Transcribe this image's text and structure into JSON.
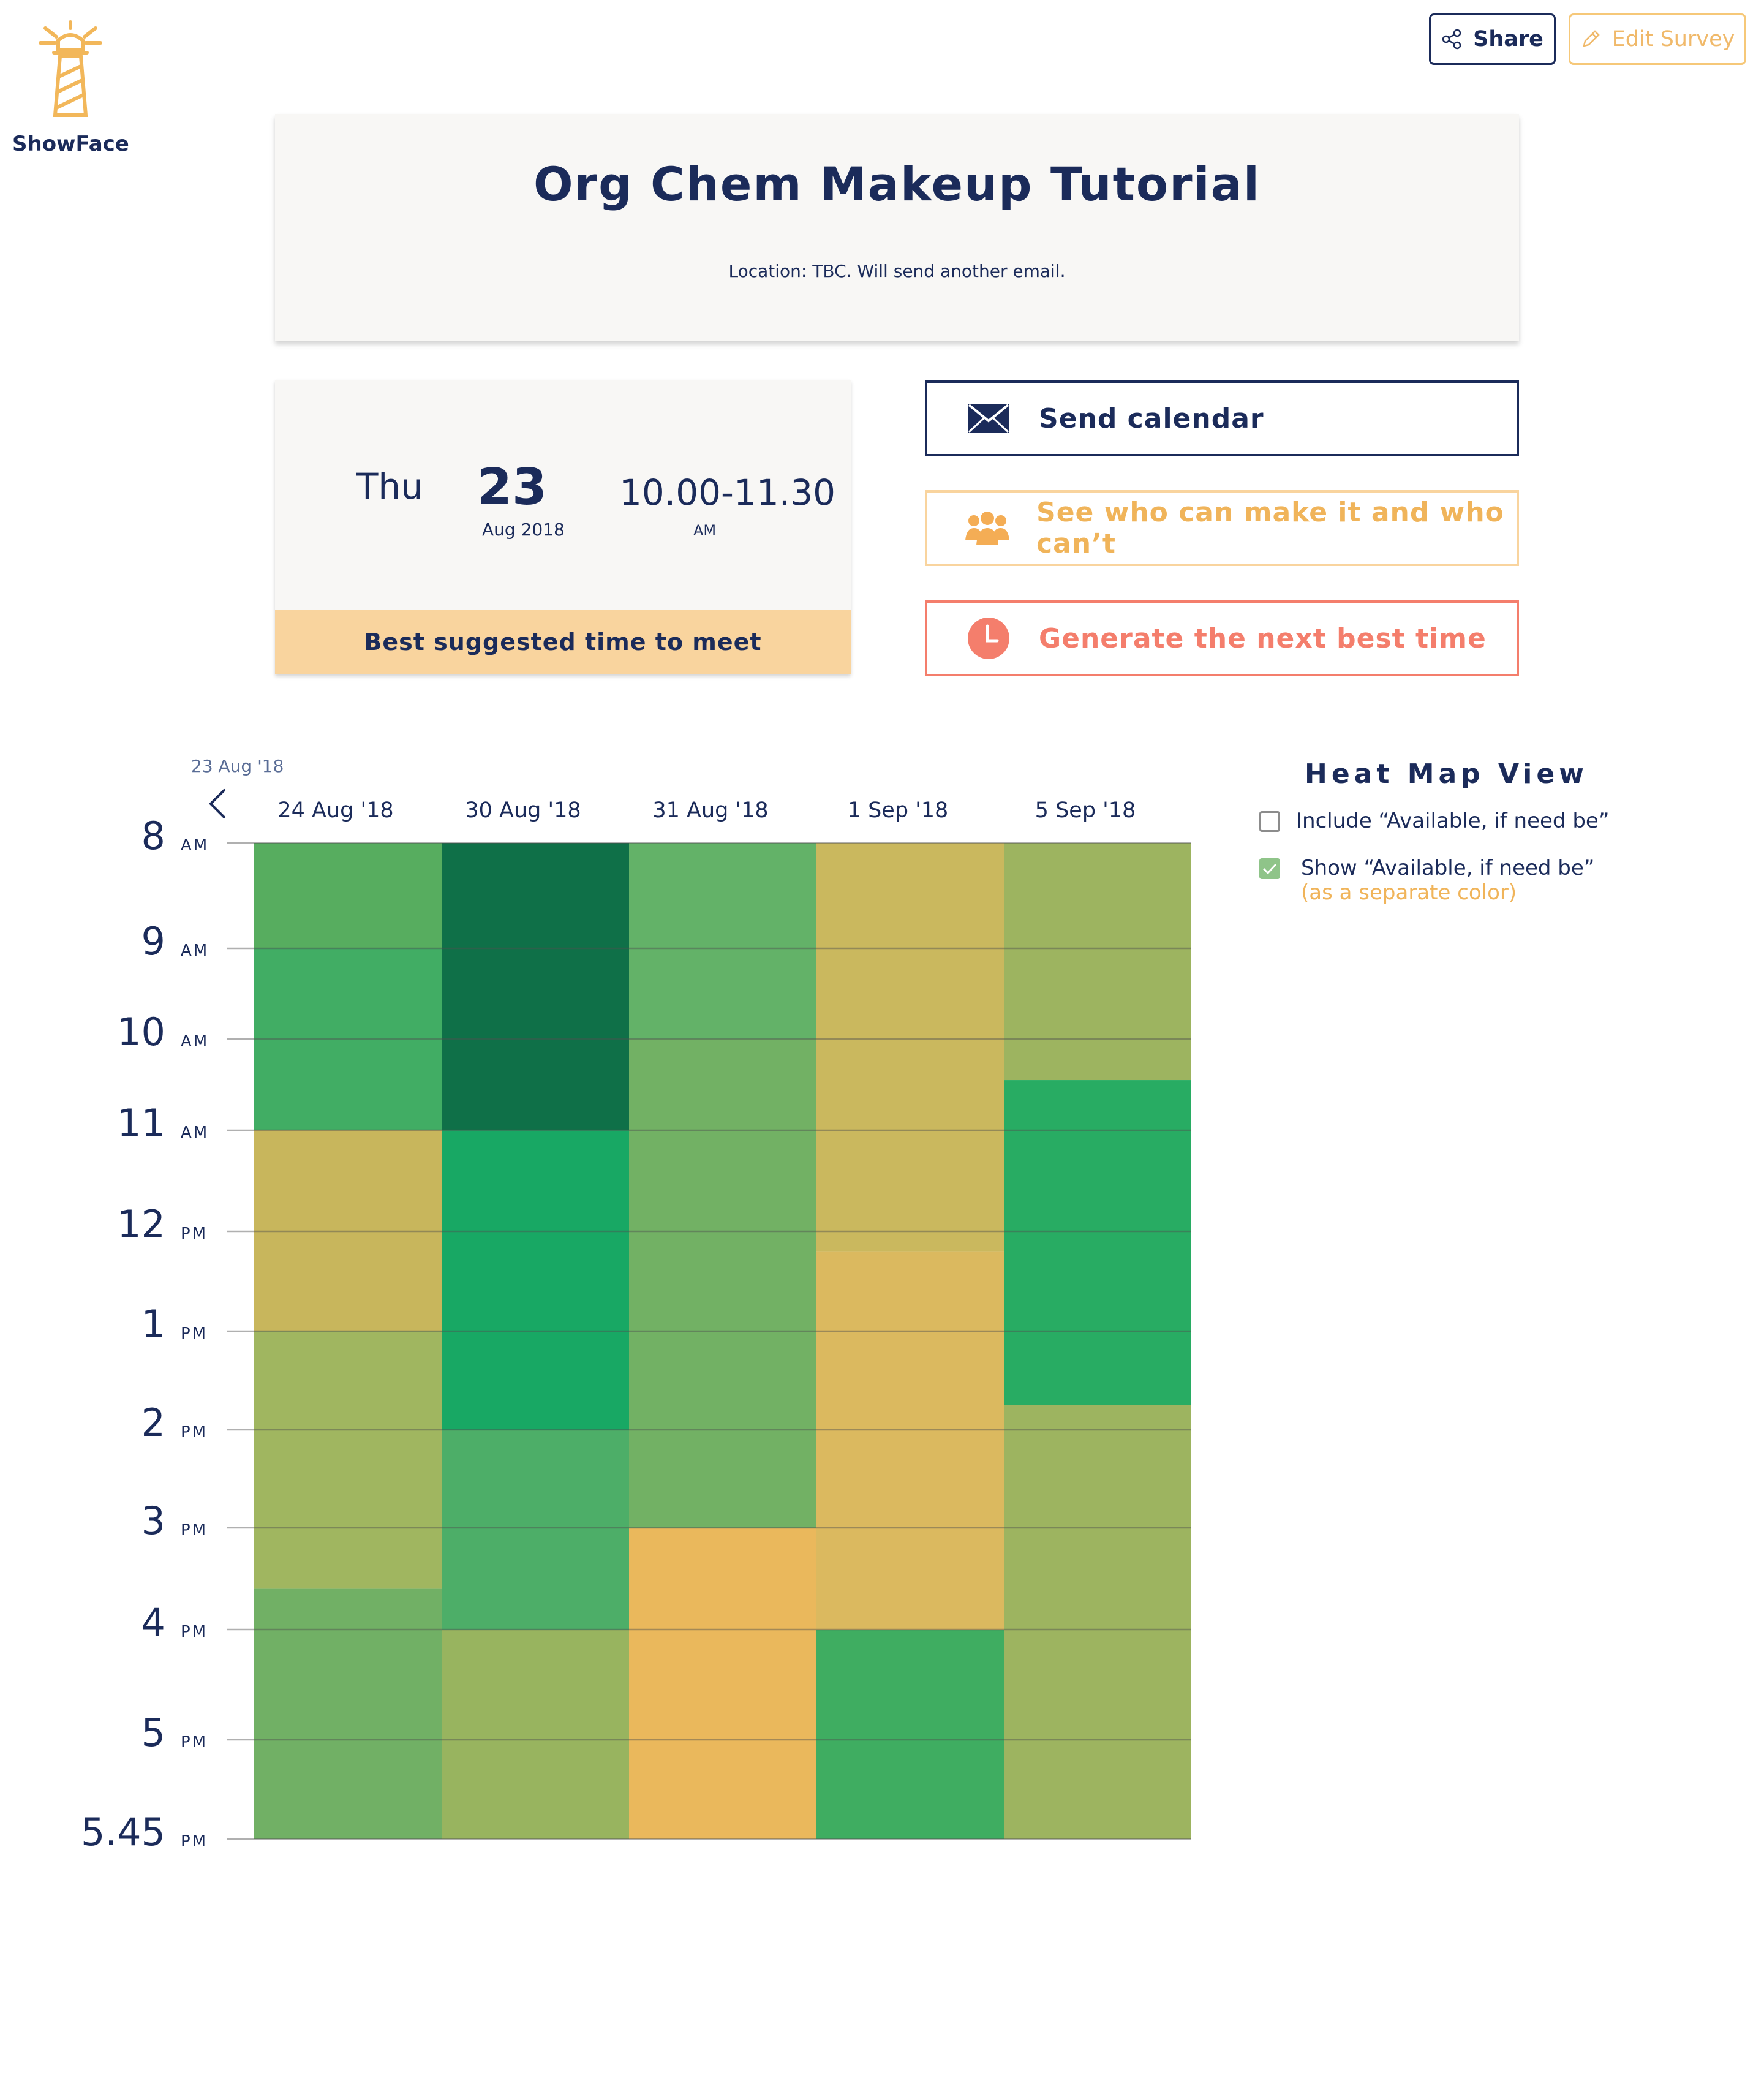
{
  "app": {
    "logo_text": "ShowFace"
  },
  "toolbar": {
    "share_label": "Share",
    "edit_label": "Edit Survey"
  },
  "event": {
    "title": "Org Chem Makeup Tutorial",
    "location": "Location: TBC. Will send another email."
  },
  "best_time": {
    "day": "Thu",
    "date": "23",
    "month_year": "Aug 2018",
    "time": "10.00-11.30",
    "period": "AM",
    "label": "Best suggested time to meet"
  },
  "actions": {
    "send_calendar": "Send calendar",
    "see_who": "See who can make it and who can’t",
    "generate_next": "Generate the next best time"
  },
  "heatmap": {
    "prev_date": "23 Aug '18",
    "dates": [
      "24 Aug '18",
      "30 Aug '18",
      "31 Aug '18",
      "1 Sep '18",
      "5 Sep '18"
    ],
    "time_labels": [
      {
        "num": "8",
        "ampm": "AM"
      },
      {
        "num": "9",
        "ampm": "AM"
      },
      {
        "num": "10",
        "ampm": "AM"
      },
      {
        "num": "11",
        "ampm": "AM"
      },
      {
        "num": "12",
        "ampm": "PM"
      },
      {
        "num": "1",
        "ampm": "PM"
      },
      {
        "num": "2",
        "ampm": "PM"
      },
      {
        "num": "3",
        "ampm": "PM"
      },
      {
        "num": "4",
        "ampm": "PM"
      },
      {
        "num": "5",
        "ampm": "PM"
      },
      {
        "num": "5.45",
        "ampm": "PM"
      }
    ],
    "columns": [
      [
        {
          "from": 8,
          "to": 9,
          "color": "#57ad5f"
        },
        {
          "from": 9,
          "to": 11,
          "color": "#41ad64"
        },
        {
          "from": 11,
          "to": 13,
          "color": "#c8b65c"
        },
        {
          "from": 13,
          "to": 15.6,
          "color": "#a0b660"
        },
        {
          "from": 15.6,
          "to": 17.75,
          "color": "#71b065"
        }
      ],
      [
        {
          "from": 8,
          "to": 11,
          "color": "#0f7048"
        },
        {
          "from": 11,
          "to": 14,
          "color": "#18a864"
        },
        {
          "from": 14,
          "to": 16,
          "color": "#4dae68"
        },
        {
          "from": 16,
          "to": 17.75,
          "color": "#98b45f"
        }
      ],
      [
        {
          "from": 8,
          "to": 10,
          "color": "#63b268"
        },
        {
          "from": 10,
          "to": 15,
          "color": "#72b164"
        },
        {
          "from": 15,
          "to": 17.75,
          "color": "#eab85c"
        }
      ],
      [
        {
          "from": 8,
          "to": 12.2,
          "color": "#cab85e"
        },
        {
          "from": 12.2,
          "to": 16,
          "color": "#dbb95f"
        },
        {
          "from": 16,
          "to": 17.75,
          "color": "#3fad61"
        }
      ],
      [
        {
          "from": 8,
          "to": 10.45,
          "color": "#9db460"
        },
        {
          "from": 10.45,
          "to": 13.75,
          "color": "#28ac63"
        },
        {
          "from": 13.75,
          "to": 17.75,
          "color": "#9db460"
        }
      ]
    ]
  },
  "legend": {
    "title": "Heat Map View",
    "include_label": "Include “Available, if need be”",
    "include_checked": false,
    "show_label": "Show “Available, if need be”",
    "show_sub": "(as a separate color)",
    "show_checked": true
  },
  "colors": {
    "navy": "#1b2b5a",
    "orange": "#f0b45a",
    "coral": "#f47e6c",
    "peach": "#f9d49e"
  }
}
